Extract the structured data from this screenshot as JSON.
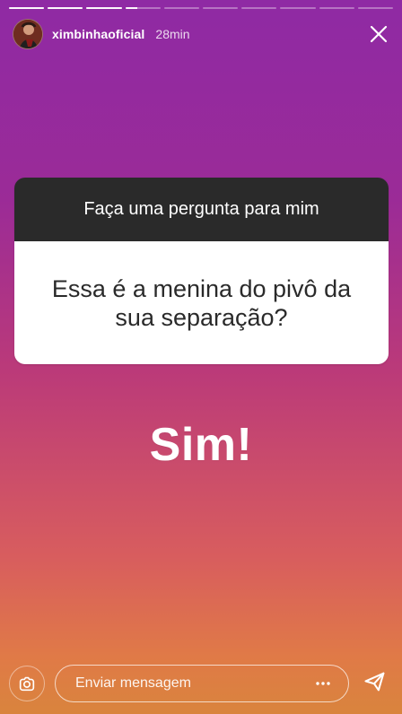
{
  "story": {
    "progress": [
      1,
      1,
      1,
      0.35,
      0,
      0,
      0,
      0,
      0,
      0
    ],
    "user": {
      "username": "ximbinhaoficial",
      "time": "28min"
    },
    "question_sticker": {
      "prompt": "Faça uma pergunta para mim",
      "question": "Essa é a menina do pivô da sua separação?"
    },
    "answer": "Sim!"
  },
  "footer": {
    "message_placeholder": "Enviar mensagem"
  },
  "icons": {
    "camera": "camera-icon",
    "close": "close-icon",
    "more": "more-dots-icon",
    "send": "send-icon"
  },
  "colors": {
    "gradient_top": "#8f2aa4",
    "gradient_middle": "#bb3a79",
    "gradient_bottom": "#e07a47",
    "card_header": "#2a2a2a",
    "card_body": "#ffffff",
    "text": "#ffffff"
  }
}
